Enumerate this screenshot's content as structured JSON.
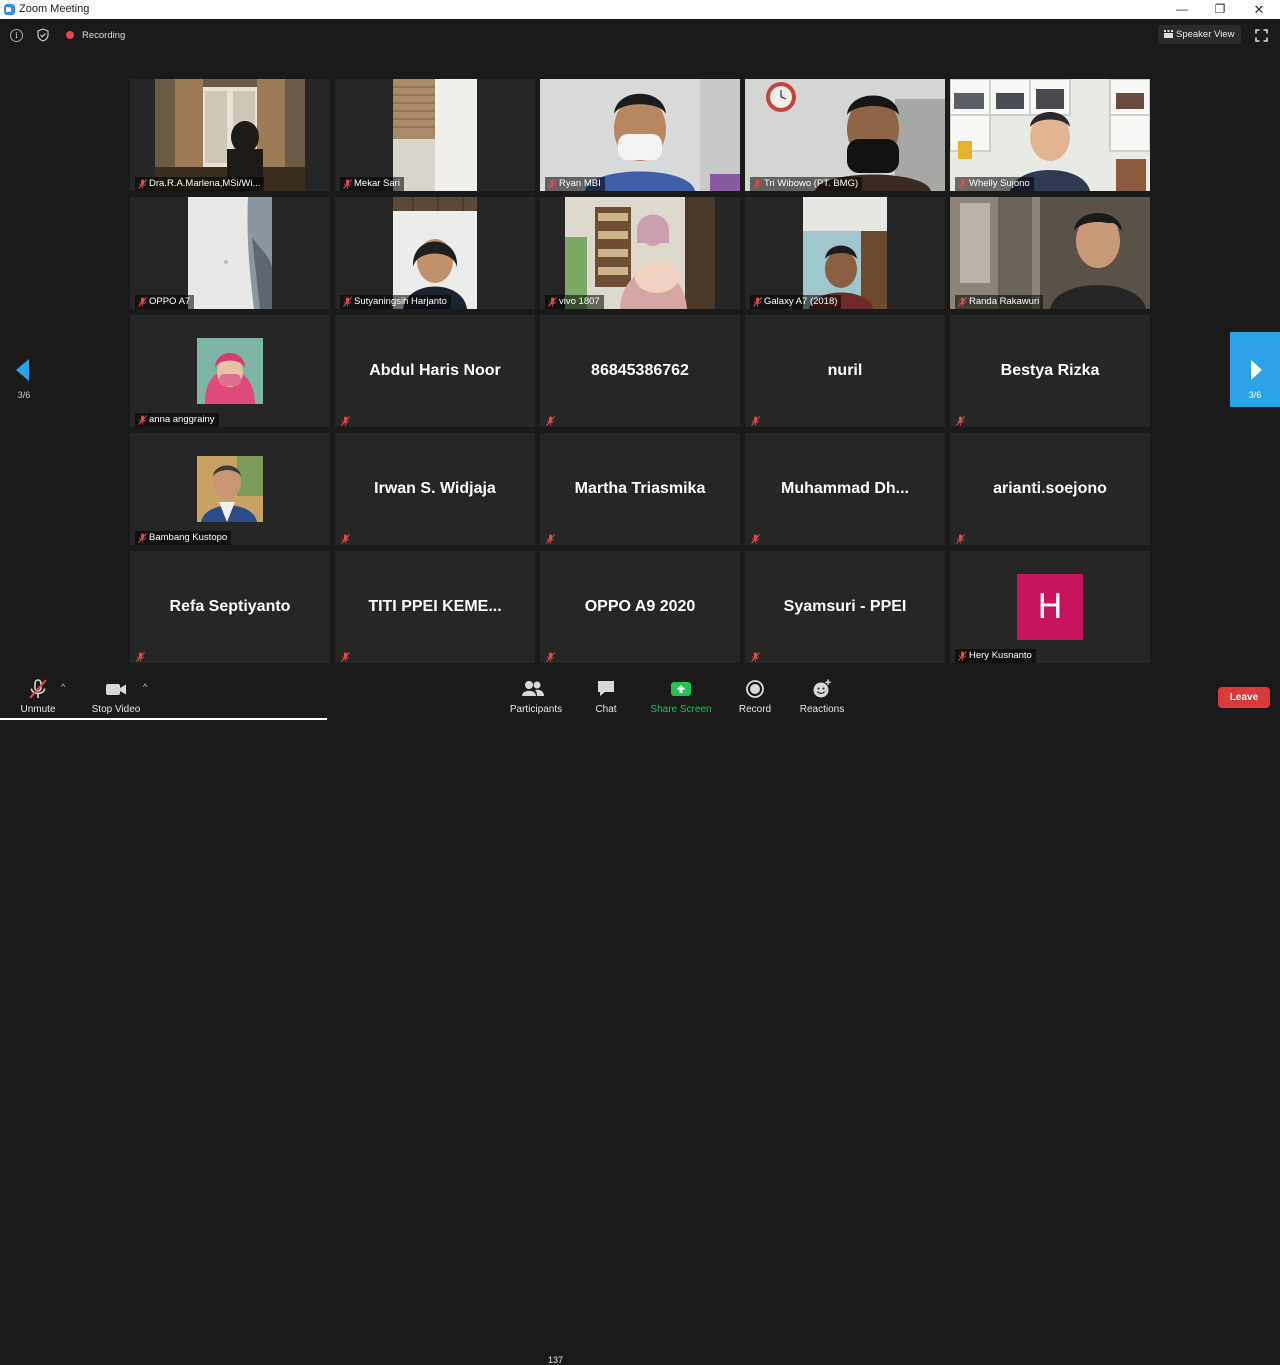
{
  "window": {
    "title": "Zoom Meeting",
    "minimize": "—",
    "maximize": "❐",
    "close": "✕"
  },
  "topbar": {
    "info": "i",
    "recording_label": "Recording",
    "speaker_view_label": "Speaker View"
  },
  "nav": {
    "left_page": "3/6",
    "right_page": "3/6"
  },
  "participants": [
    {
      "label": "Dra.R.A.Marlena,MSi/Wi...",
      "video": true
    },
    {
      "label": "Mekar Sari",
      "video": true
    },
    {
      "label": "Ryan MBI",
      "video": true
    },
    {
      "label": "Tri Wibowo (PT. BMG)",
      "video": true
    },
    {
      "label": "Whelly Sujono",
      "video": true
    },
    {
      "label": "OPPO A7",
      "video": true
    },
    {
      "label": "Sutyaningsih Harjanto",
      "video": true
    },
    {
      "label": "vivo 1807",
      "video": true
    },
    {
      "label": "Galaxy A7 (2018)",
      "video": true
    },
    {
      "label": "Randa Rakawuri",
      "video": true
    },
    {
      "label": "anna anggrainy",
      "avatar": true
    },
    {
      "big_name": "Abdul Haris Noor"
    },
    {
      "big_name": "86845386762"
    },
    {
      "big_name": "nuril"
    },
    {
      "big_name": "Bestya Rizka"
    },
    {
      "label": "Bambang Kustopo",
      "avatar": true
    },
    {
      "big_name": "Irwan S. Widjaja"
    },
    {
      "big_name": "Martha Triasmika"
    },
    {
      "big_name": "Muhammad  Dh..."
    },
    {
      "big_name": "arianti.soejono"
    },
    {
      "big_name": "Refa Septiyanto"
    },
    {
      "big_name": "TITI  PPEI KEME..."
    },
    {
      "big_name": "OPPO A9 2020"
    },
    {
      "big_name": "Syamsuri - PPEI"
    },
    {
      "label": "Hery Kusnanto",
      "letter": "H"
    }
  ],
  "toolbar": {
    "unmute": "Unmute",
    "stop_video": "Stop Video",
    "participants": "Participants",
    "participants_count": "137",
    "chat": "Chat",
    "share_screen": "Share Screen",
    "record": "Record",
    "reactions": "Reactions",
    "leave": "Leave"
  },
  "colors": {
    "accent_blue": "#2aa3e8",
    "share_green": "#23c552",
    "leave_red": "#d63a3a",
    "mute_red": "#e34b4b",
    "letter_avatar": "#c8145f"
  }
}
